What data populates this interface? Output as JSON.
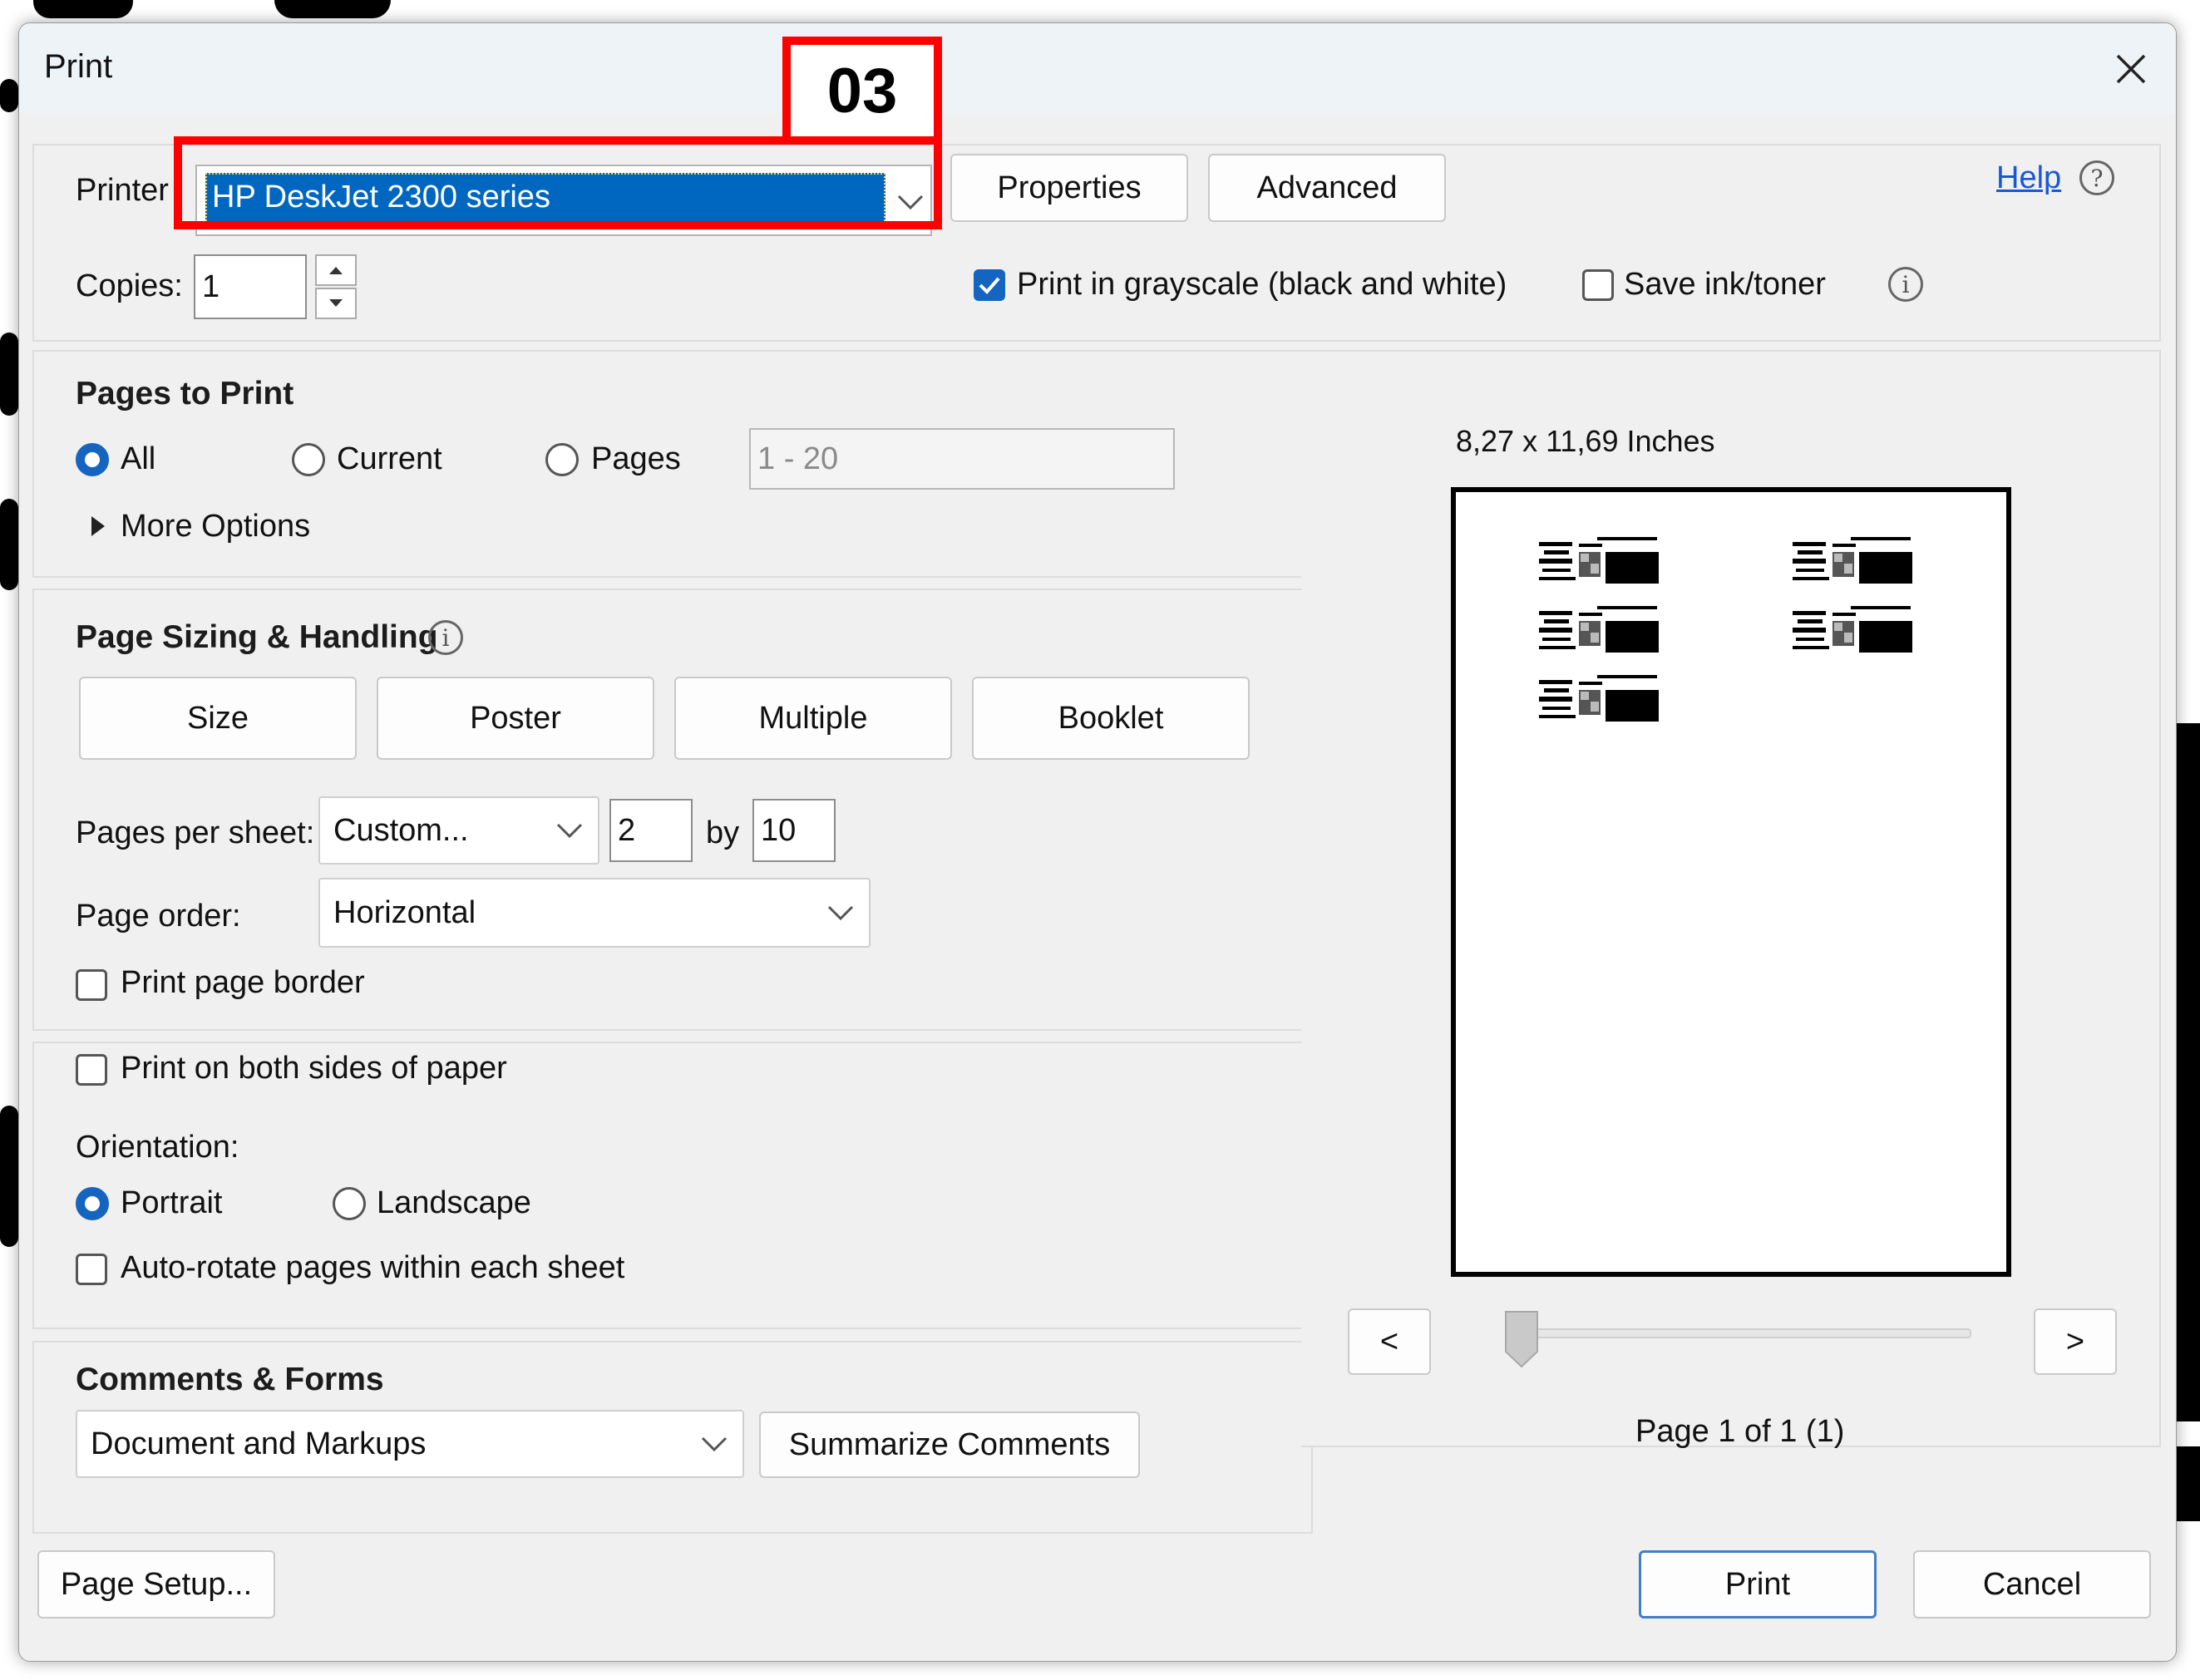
{
  "dialog": {
    "title": "Print",
    "close_icon": "close-icon"
  },
  "annotation": {
    "step_label": "03",
    "color": "#ff0000"
  },
  "printer": {
    "label": "Printer",
    "selected": "HP DeskJet 2300 series",
    "properties_label": "Properties",
    "advanced_label": "Advanced",
    "help_label": "Help"
  },
  "copies": {
    "label": "Copies:",
    "value": "1"
  },
  "options": {
    "grayscale_label": "Print in grayscale (black and white)",
    "grayscale_checked": true,
    "save_ink_label": "Save ink/toner",
    "save_ink_checked": false
  },
  "pages_to_print": {
    "heading": "Pages to Print",
    "all_label": "All",
    "current_label": "Current",
    "pages_label": "Pages",
    "pages_range_placeholder": "1 - 20",
    "selected": "All",
    "more_options_label": "More Options"
  },
  "page_sizing": {
    "heading": "Page Sizing & Handling",
    "tabs": [
      "Size",
      "Poster",
      "Multiple",
      "Booklet"
    ],
    "pages_per_sheet_label": "Pages per sheet:",
    "pages_per_sheet_value": "Custom...",
    "per_sheet_x": "2",
    "by_label": "by",
    "per_sheet_y": "10",
    "page_order_label": "Page order:",
    "page_order_value": "Horizontal",
    "print_border_label": "Print page border",
    "print_border_checked": false
  },
  "duplex": {
    "both_sides_label": "Print on both sides of paper",
    "both_sides_checked": false,
    "orientation_label": "Orientation:",
    "portrait_label": "Portrait",
    "landscape_label": "Landscape",
    "orientation_selected": "Portrait",
    "auto_rotate_label": "Auto-rotate pages within each sheet",
    "auto_rotate_checked": false
  },
  "comments_forms": {
    "heading": "Comments & Forms",
    "value": "Document and Markups",
    "summarize_label": "Summarize Comments"
  },
  "preview": {
    "size_label": "8,27 x 11,69 Inches",
    "prev_label": "<",
    "next_label": ">",
    "page_status": "Page 1 of 1 (1)",
    "slider_position": 0
  },
  "footer": {
    "page_setup_label": "Page Setup...",
    "print_label": "Print",
    "cancel_label": "Cancel"
  }
}
